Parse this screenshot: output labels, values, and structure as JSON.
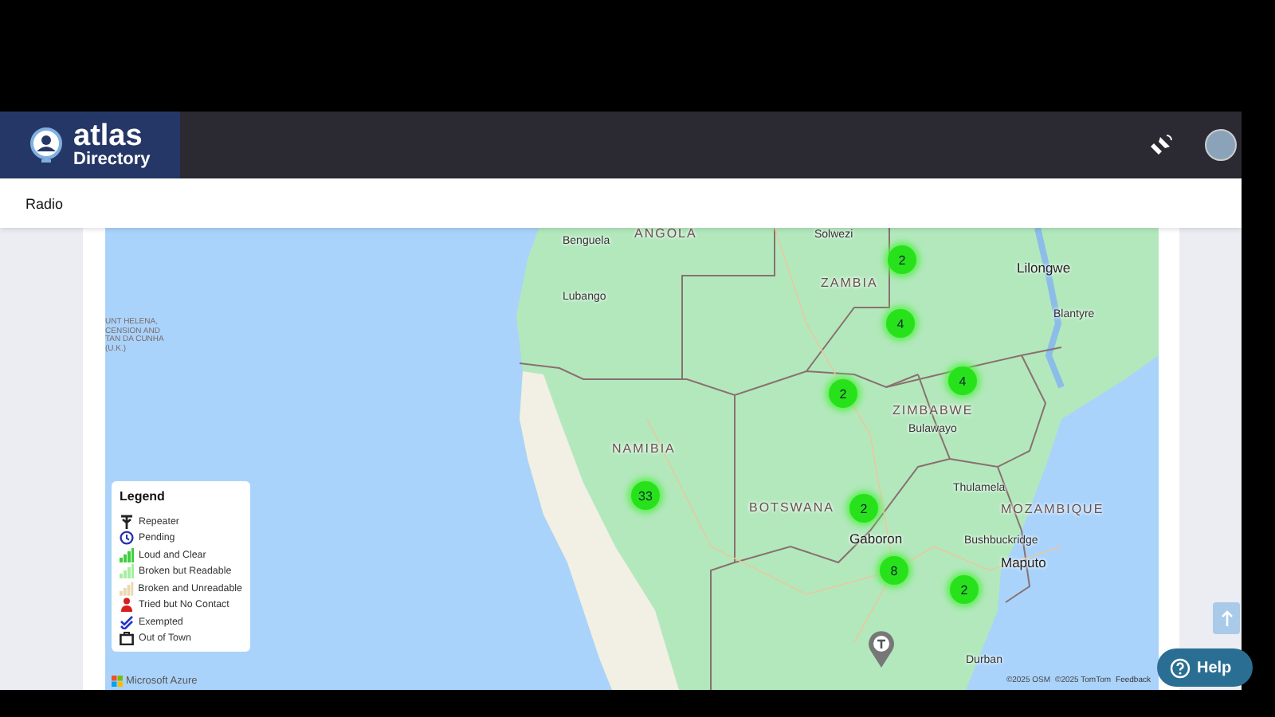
{
  "header": {
    "logo_title": "atlas",
    "logo_subtitle": "Directory"
  },
  "tabs": [
    {
      "label": "Radio",
      "selected": true
    }
  ],
  "map": {
    "labels": [
      {
        "kind": "country",
        "text": "ANGOLA"
      },
      {
        "kind": "city",
        "text": "Benguela"
      },
      {
        "kind": "city",
        "text": "Lubango"
      },
      {
        "kind": "territory",
        "text": "UNT HELENA,\nCENSION AND\nTAN DA CUNHA\n(U.K.)"
      },
      {
        "kind": "country",
        "text": "NAMIBIA"
      },
      {
        "kind": "city",
        "text": "Solwezi"
      },
      {
        "kind": "country",
        "text": "ZAMBIA"
      },
      {
        "kind": "capital",
        "text": "Lilongwe"
      },
      {
        "kind": "city",
        "text": "Blantyre"
      },
      {
        "kind": "country",
        "text": "ZIMBABWE"
      },
      {
        "kind": "city",
        "text": "Bulawayo"
      },
      {
        "kind": "country",
        "text": "BOTSWANA"
      },
      {
        "kind": "capital",
        "text": "Gaboron"
      },
      {
        "kind": "city",
        "text": "Thulamela"
      },
      {
        "kind": "country",
        "text": "MOZAMBIQUE"
      },
      {
        "kind": "city",
        "text": "Bushbuckridge"
      },
      {
        "kind": "capital",
        "text": "Maputo"
      },
      {
        "kind": "city",
        "text": "Durban"
      }
    ],
    "clusters": [
      "2",
      "4",
      "2",
      "4",
      "33",
      "2",
      "8",
      "2"
    ],
    "legend": {
      "title": "Legend",
      "items": [
        {
          "kind": "repeater",
          "label": "Repeater"
        },
        {
          "kind": "pending",
          "label": "Pending"
        },
        {
          "kind": "loud",
          "label": "Loud and Clear"
        },
        {
          "kind": "readable",
          "label": "Broken but Readable"
        },
        {
          "kind": "unreadable",
          "label": "Broken and Unreadable"
        },
        {
          "kind": "tried",
          "label": "Tried but No Contact"
        },
        {
          "kind": "exempted",
          "label": "Exempted"
        },
        {
          "kind": "away",
          "label": "Out of Town"
        }
      ]
    },
    "provider": "Microsoft Azure",
    "attribution": [
      "©2025 OSM",
      "©2025 TomTom"
    ],
    "feedback": "Feedback"
  },
  "help": "Help"
}
